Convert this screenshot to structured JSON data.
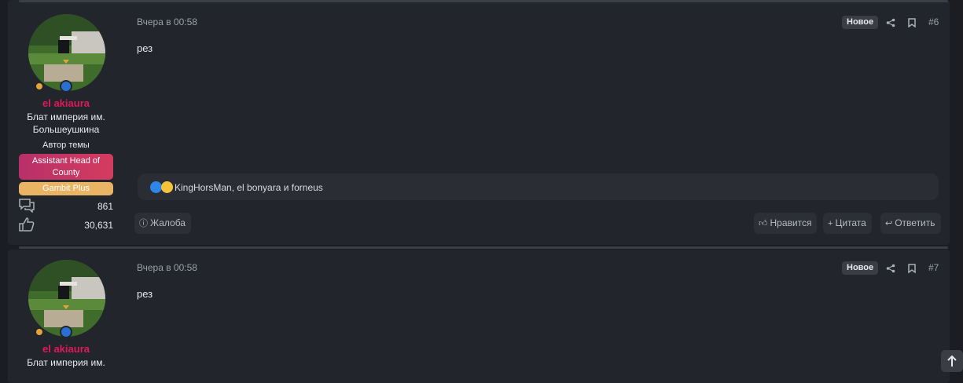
{
  "posts": [
    {
      "date": "Вчера в 00:58",
      "new_badge": "Новое",
      "number": "#6",
      "body": "рез",
      "author": {
        "username": "el akiaura",
        "title": "Блат империя им. Большеушкина",
        "role": "Автор темы",
        "banner_primary": "Assistant Head of County",
        "banner_secondary": "Gambit Plus",
        "messages_count": "861",
        "reactions_count": "30,631"
      },
      "reactions_text": "KingHorsMan, el bonyara и forneus",
      "actions": {
        "report": "Жалоба",
        "like": "Нравится",
        "quote": "Цитата",
        "reply": "Ответить"
      }
    },
    {
      "date": "Вчера в 00:58",
      "new_badge": "Новое",
      "number": "#7",
      "body": "рез",
      "author": {
        "username": "el akiaura",
        "title_partial": "Блат империя им."
      }
    }
  ],
  "colors": {
    "background": "#1b1d22",
    "post_background": "#22252b",
    "username": "#e0195a",
    "banner_primary": "#c8356a",
    "banner_secondary": "#e9b565"
  },
  "icons": [
    "share-icon",
    "bookmark-icon",
    "messages-icon",
    "thumbs-up-icon",
    "info-icon",
    "plus-icon",
    "reply-icon",
    "arrow-up-icon"
  ]
}
